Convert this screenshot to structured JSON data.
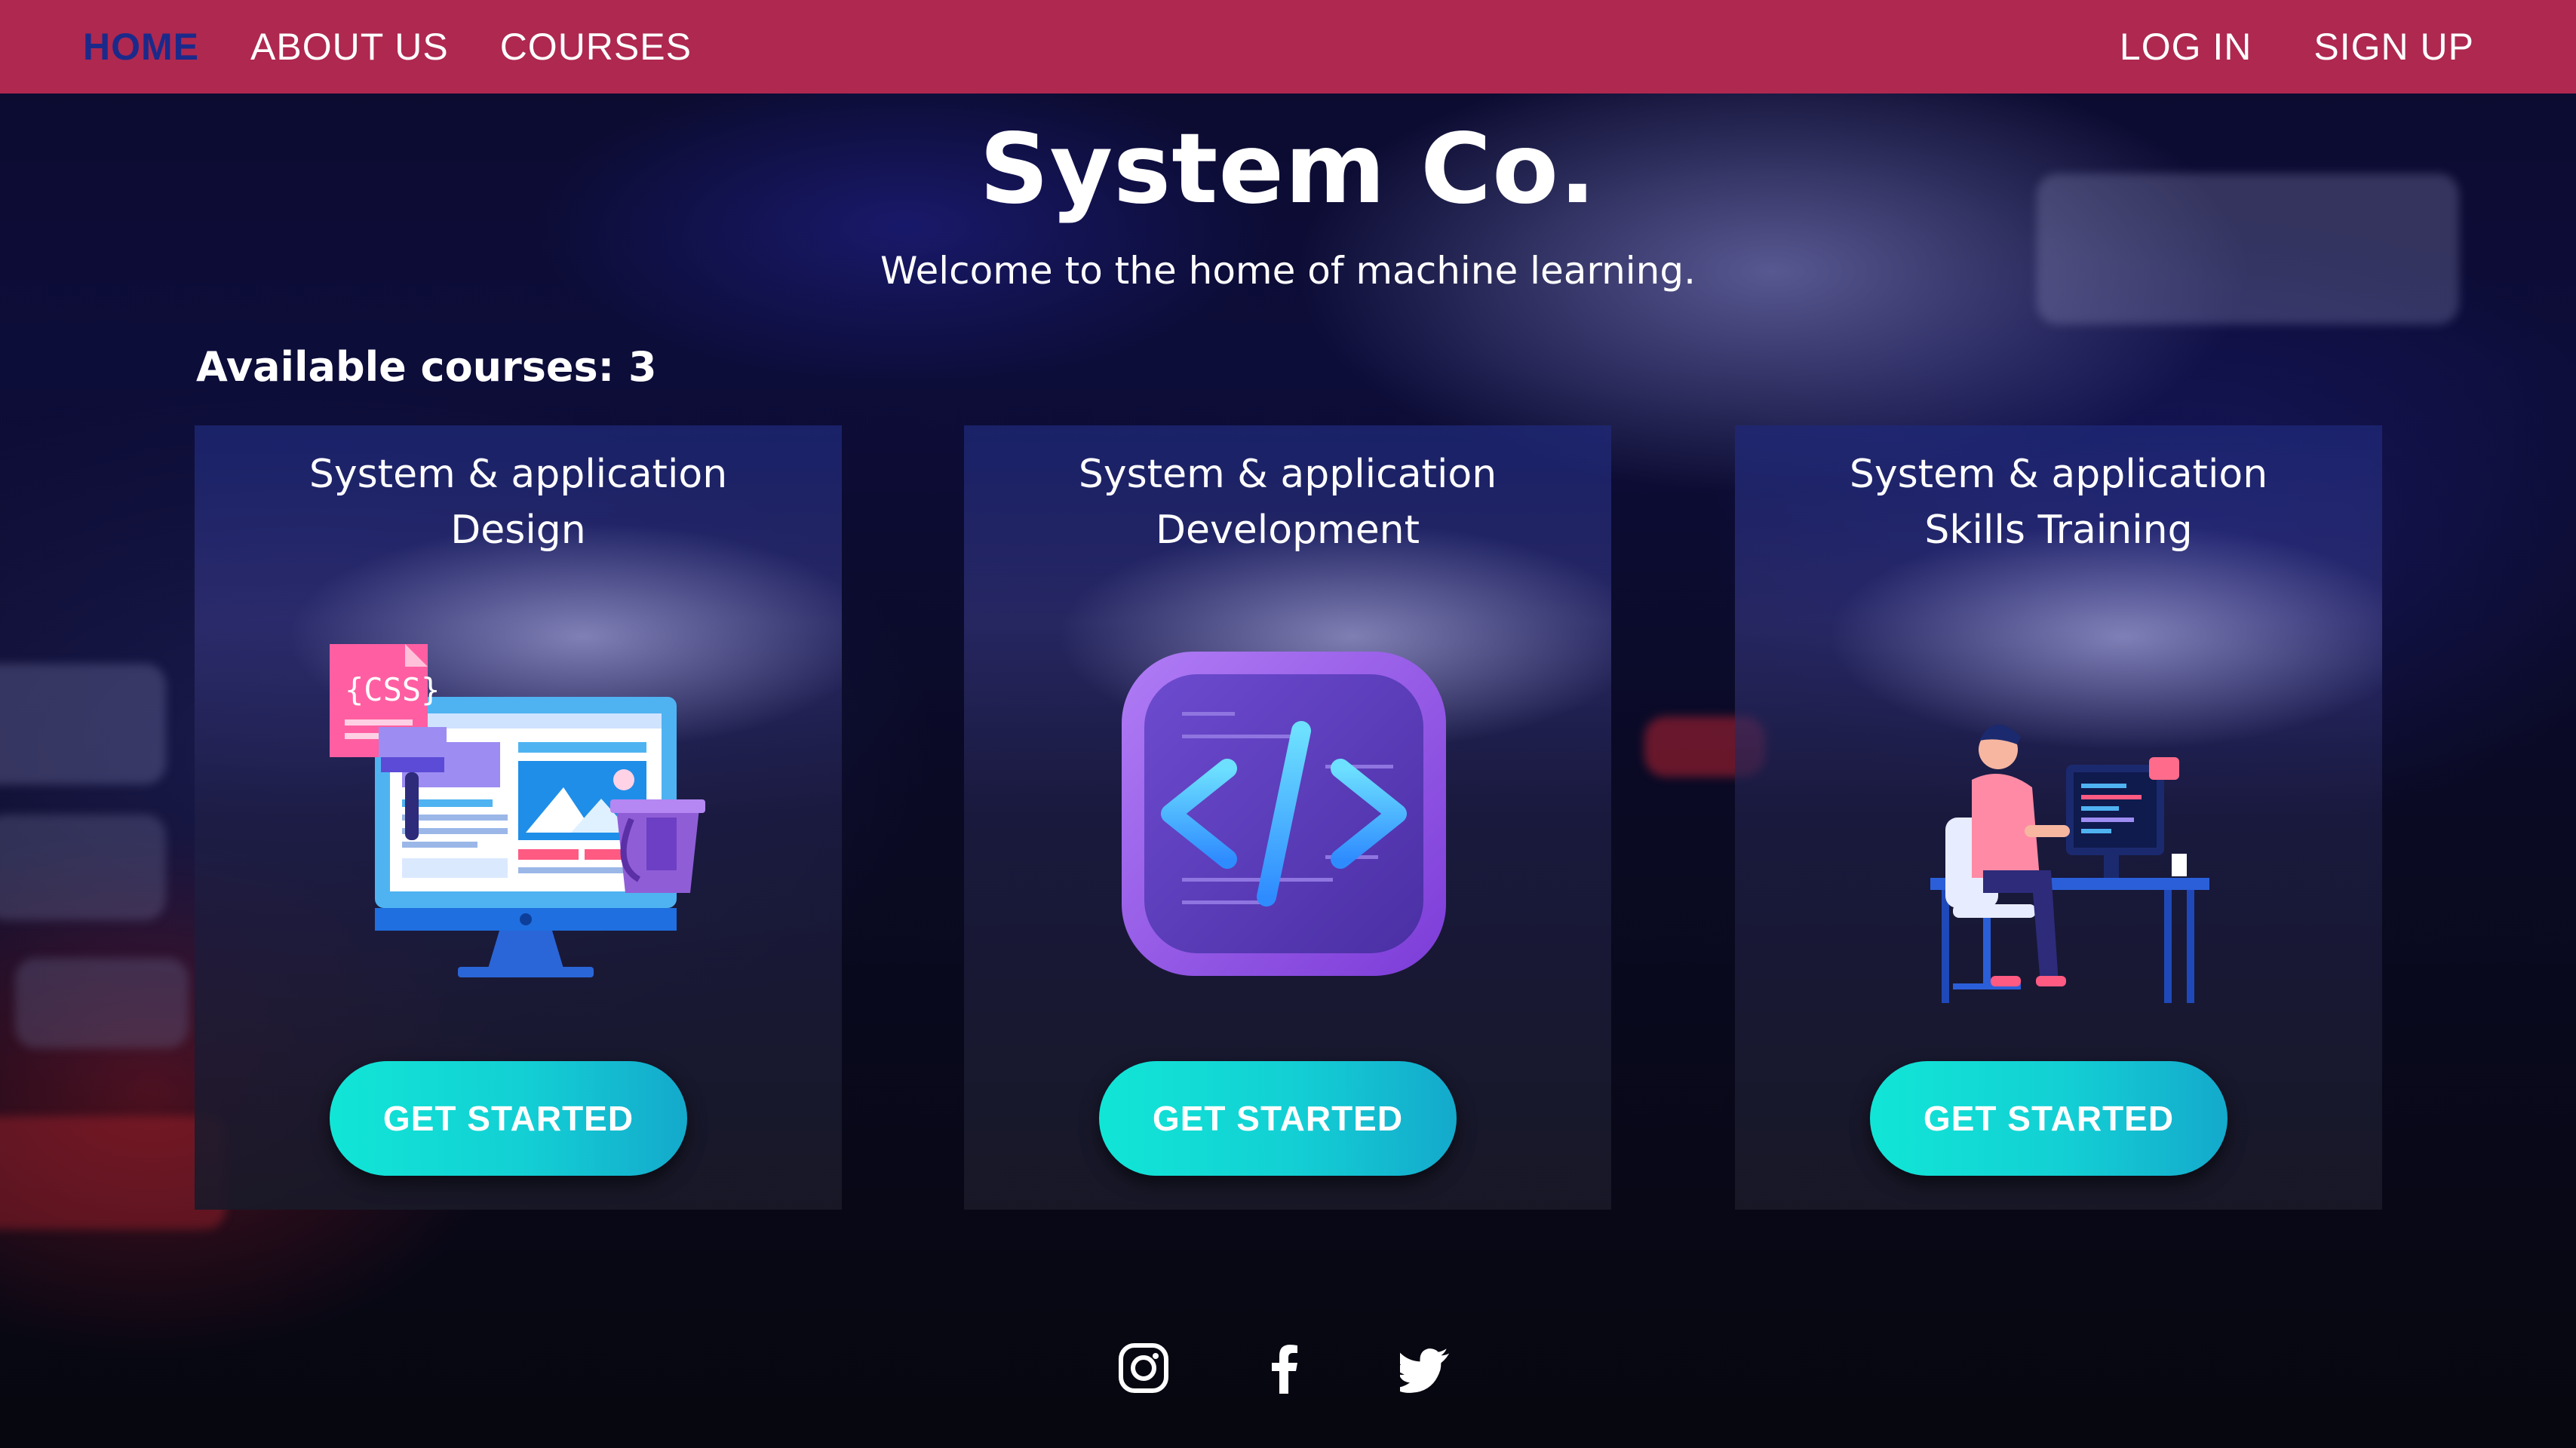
{
  "nav": {
    "left": [
      {
        "label": "HOME",
        "active": true
      },
      {
        "label": "ABOUT US",
        "active": false
      },
      {
        "label": "COURSES",
        "active": false
      }
    ],
    "right": [
      {
        "label": "LOG IN"
      },
      {
        "label": "SIGN UP"
      }
    ]
  },
  "hero": {
    "title": "System Co.",
    "tagline": "Welcome to the home of machine learning."
  },
  "courses": {
    "count_label": "Available courses: 3",
    "items": [
      {
        "title_line1": "System & application",
        "title_line2": "Design",
        "illustration": "web-design-monitor-icon",
        "button": "GET STARTED"
      },
      {
        "title_line1": "System & application",
        "title_line2": "Development",
        "illustration": "code-brackets-icon",
        "button": "GET STARTED"
      },
      {
        "title_line1": "System & application",
        "title_line2": "Skills Training",
        "illustration": "person-at-computer-icon",
        "button": "GET STARTED"
      }
    ]
  },
  "footer": {
    "social": [
      "instagram-icon",
      "facebook-icon",
      "twitter-icon"
    ]
  },
  "colors": {
    "topbar": "#ae2850",
    "active_nav": "#1b2a8a",
    "button_start": "#11e6d6",
    "button_end": "#14a9cc"
  }
}
